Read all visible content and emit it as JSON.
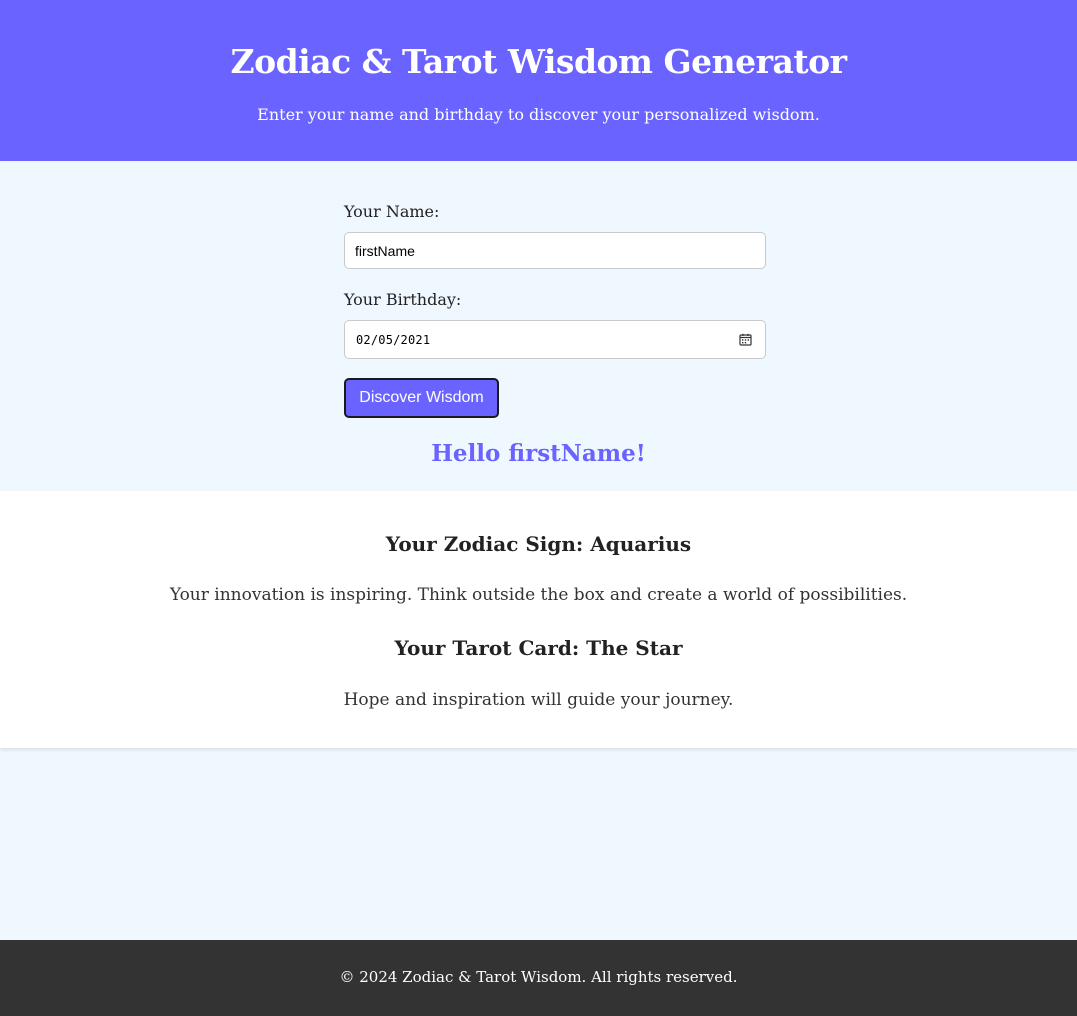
{
  "header": {
    "title": "Zodiac & Tarot Wisdom Generator",
    "subtitle": "Enter your name and birthday to discover your personalized wisdom."
  },
  "form": {
    "name_label": "Your Name:",
    "name_value": "firstName",
    "birthday_label": "Your Birthday:",
    "birthday_value": "02/05/2021",
    "birthday_icon": "calendar-icon",
    "submit_label": "Discover Wisdom"
  },
  "greeting": "Hello firstName!",
  "result": {
    "zodiac_heading": "Your Zodiac Sign: Aquarius",
    "zodiac_text": "Your innovation is inspiring. Think outside the box and create a world of possibilities.",
    "tarot_heading": "Your Tarot Card: The Star",
    "tarot_text": "Hope and inspiration will guide your journey."
  },
  "footer": {
    "text": "© 2024 Zodiac & Tarot Wisdom. All rights reserved."
  },
  "colors": {
    "accent": "#6b63ff",
    "page_background": "#f0f8ff",
    "footer_background": "#333333"
  }
}
